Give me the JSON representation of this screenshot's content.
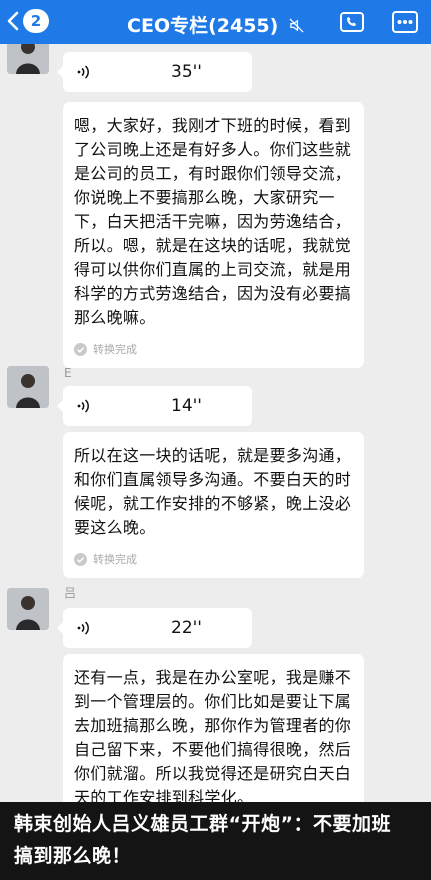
{
  "header": {
    "back_count": "2",
    "title": "CEO专栏(2455)",
    "colors": {
      "bar": "#1f7ae8",
      "text": "#ffffff"
    },
    "icons": [
      "back-arrow-icon",
      "mute-icon",
      "voice-call-icon",
      "more-icon"
    ]
  },
  "messages": [
    {
      "sender": "",
      "voice_duration": "35''",
      "transcript": "嗯，大家好，我刚才下班的时候，看到了公司晚上还是有好多人。你们这些就是公司的员工，有时跟你们领导交流，你说晚上不要搞那么晚，大家研究一下，白天把活干完嘛，因为劳逸结合，所以。嗯，就是在这块的话呢，我就觉得可以供你们直属的上司交流，就是用科学的方式劳逸结合，因为没有必要搞那么晚嘛。",
      "status": "转换完成"
    },
    {
      "sender": "E",
      "voice_duration": "14''",
      "transcript": "所以在这一块的话呢，就是要多沟通，和你们直属领导多沟通。不要白天的时候呢，就工作安排的不够紧，晚上没必要这么晚。",
      "status": "转换完成"
    },
    {
      "sender": "吕",
      "voice_duration": "22''",
      "transcript": "还有一点，我是在办公室呢，我是赚不到一个管理层的。你们比如是要让下属去加班搞那么晚，那你作为管理者的你自己留下来，不要他们搞得很晚，然后你们就溜。所以我觉得还是研究白天白天的工作安排到科学化。",
      "status": ""
    }
  ],
  "caption": {
    "line1": "韩束创始人吕义雄员工群“开炮”：不要加班",
    "line2": "搞到那么晚！"
  }
}
